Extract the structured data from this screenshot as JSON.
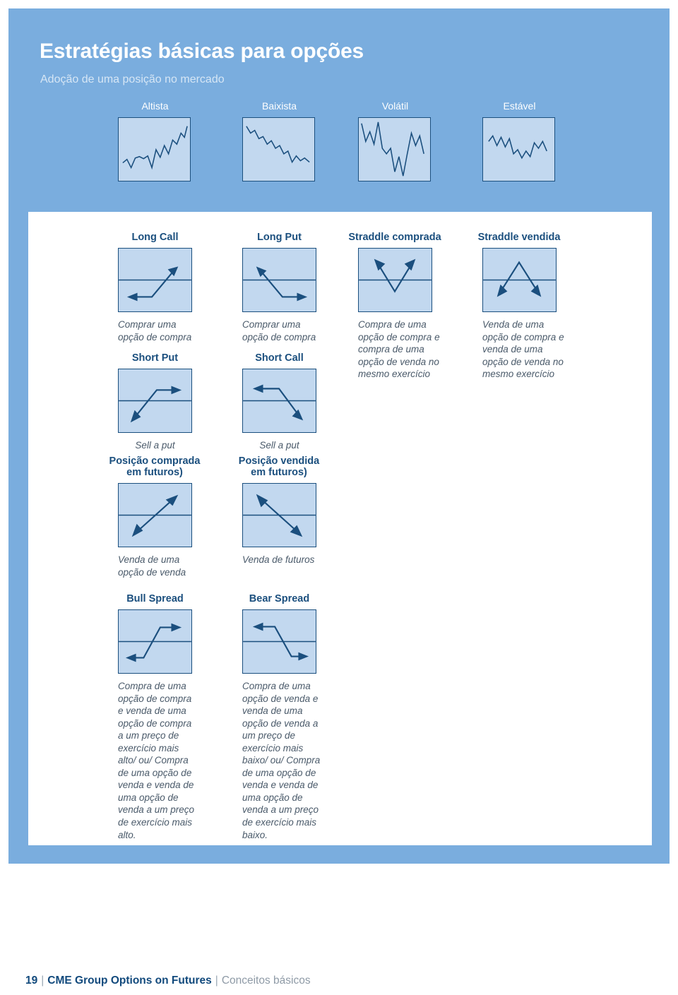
{
  "header": {
    "title": "Estratégias básicas para opções",
    "subtitle": "Adoção de uma posição no mercado"
  },
  "sentiments": [
    {
      "label": "Altista",
      "icon": "uptrend-line-icon"
    },
    {
      "label": "Baixista",
      "icon": "downtrend-line-icon"
    },
    {
      "label": "Volátil",
      "icon": "volatile-line-icon"
    },
    {
      "label": "Estável",
      "icon": "stable-line-icon"
    }
  ],
  "strategies": {
    "row1": [
      {
        "title": "Long Call",
        "caption": "Comprar uma opção de compra",
        "icon": "long-call-payoff-icon"
      },
      {
        "title": "Long Put",
        "caption": "Comprar uma opção de compra",
        "icon": "long-put-payoff-icon"
      },
      {
        "title": "Straddle comprada",
        "caption": "Compra de uma opção de compra e compra de uma opção de venda no mesmo exercício",
        "icon": "long-straddle-payoff-icon"
      },
      {
        "title": "Straddle vendida",
        "caption": "Venda de uma opção de compra e venda de uma opção de venda no mesmo exercício",
        "icon": "short-straddle-payoff-icon"
      }
    ],
    "row2": [
      {
        "title": "Short Put",
        "caption": "Sell a put",
        "icon": "short-put-payoff-icon"
      },
      {
        "title": "Short Call",
        "caption": "Sell a put",
        "icon": "short-call-payoff-icon"
      }
    ],
    "row3": [
      {
        "title_line1": "Posição comprada",
        "title_line2": "em futuros)",
        "caption": "Venda de uma opção de venda",
        "icon": "long-futures-payoff-icon"
      },
      {
        "title_line1": "Posição vendida",
        "title_line2": "em futuros)",
        "caption": "Venda de futuros",
        "icon": "short-futures-payoff-icon"
      }
    ],
    "row4": [
      {
        "title": "Bull Spread",
        "caption": "Compra de uma opção de compra e venda de uma opção de compra a um preço de exercício mais alto/ ou/ Compra de uma opção de venda e venda de uma opção de venda a um preço de exercício mais alto.",
        "icon": "bull-spread-payoff-icon"
      },
      {
        "title": "Bear Spread",
        "caption": "Compra de uma opção de venda e venda de uma opção de venda a um preço de exercício mais baixo/ ou/ Compra de uma opção de venda e venda de uma opção de venda a um preço de exercício mais baixo.",
        "icon": "bear-spread-payoff-icon"
      }
    ]
  },
  "footer": {
    "page": "19",
    "separator": "|",
    "brand": "CME Group Options on Futures",
    "section": "Conceitos básicos"
  },
  "colors": {
    "panel_blue": "#7aadde",
    "box_fill": "#c2d8ef",
    "line_navy": "#1b4f7e",
    "title_white": "#ffffff",
    "caption_grey": "#4a5a6a"
  }
}
